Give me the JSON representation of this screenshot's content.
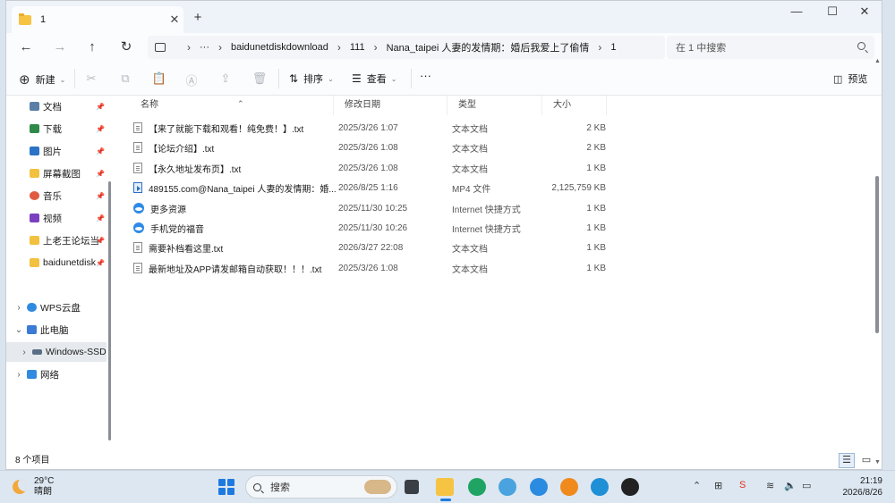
{
  "window": {
    "tab_title": "1",
    "tab_close": "✕",
    "new_tab": "+",
    "min": "—",
    "max": "☐",
    "close": "✕"
  },
  "nav": {
    "back": "←",
    "forward": "→",
    "up": "↑",
    "refresh": "↻"
  },
  "address": {
    "more": "···",
    "crumbs": [
      "baidunetdiskdownload",
      "111",
      "Nana_taipei 人妻的发情期：婚后我爱上了偷情",
      "1"
    ],
    "separator": "›"
  },
  "search": {
    "placeholder": "在 1 中搜索"
  },
  "toolbar": {
    "new_label": "新建",
    "sort_label": "排序",
    "view_label": "查看",
    "more": "···",
    "preview_label": "预览"
  },
  "sidebar": {
    "items": [
      {
        "label": "文档",
        "color": "#5b7fa6"
      },
      {
        "label": "下载",
        "color": "#2f8a4a"
      },
      {
        "label": "图片",
        "color": "#2b73c4"
      },
      {
        "label": "屏幕截图",
        "color": "#f2c140"
      },
      {
        "label": "音乐",
        "color": "#e05b3f"
      },
      {
        "label": "视频",
        "color": "#7b3fbf"
      },
      {
        "label": "上老王论坛当",
        "color": "#f2c140"
      },
      {
        "label": "baidunetdisk",
        "color": "#f2c140"
      }
    ],
    "tree": [
      {
        "label": "WPS云盘",
        "color": "#2f8ae0"
      },
      {
        "label": "此电脑",
        "color": "#3a7bd5"
      },
      {
        "label": "Windows-SSD",
        "color": "#5a6f86"
      },
      {
        "label": "网络",
        "color": "#2f8ae0"
      }
    ]
  },
  "columns": {
    "name": "名称",
    "date": "修改日期",
    "type": "类型",
    "size": "大小"
  },
  "files": [
    {
      "name": "【来了就能下载和观看！纯免费！】.txt",
      "date": "2025/3/26 1:07",
      "type": "文本文档",
      "size": "2 KB",
      "icon": "txt"
    },
    {
      "name": "【论坛介绍】.txt",
      "date": "2025/3/26 1:08",
      "type": "文本文档",
      "size": "2 KB",
      "icon": "txt"
    },
    {
      "name": "【永久地址发布页】.txt",
      "date": "2025/3/26 1:08",
      "type": "文本文档",
      "size": "1 KB",
      "icon": "txt"
    },
    {
      "name": "489155.com@Nana_taipei 人妻的发情期：婚...",
      "date": "2026/8/25 1:16",
      "type": "MP4 文件",
      "size": "2,125,759 KB",
      "icon": "mp4"
    },
    {
      "name": "更多资源",
      "date": "2025/11/30 10:25",
      "type": "Internet 快捷方式",
      "size": "1 KB",
      "icon": "url"
    },
    {
      "name": "手机党的福音",
      "date": "2025/11/30 10:26",
      "type": "Internet 快捷方式",
      "size": "1 KB",
      "icon": "url"
    },
    {
      "name": "需要补档看这里.txt",
      "date": "2026/3/27 22:08",
      "type": "文本文档",
      "size": "1 KB",
      "icon": "txt"
    },
    {
      "name": "最新地址及APP请发邮箱自动获取！！！.txt",
      "date": "2025/3/26 1:08",
      "type": "文本文档",
      "size": "1 KB",
      "icon": "txt"
    }
  ],
  "status": {
    "count": "8 个项目"
  },
  "taskbar": {
    "temperature": "29°C",
    "condition": "晴朗",
    "search_label": "搜索",
    "time": "21:19",
    "date": "2026/8/26"
  }
}
